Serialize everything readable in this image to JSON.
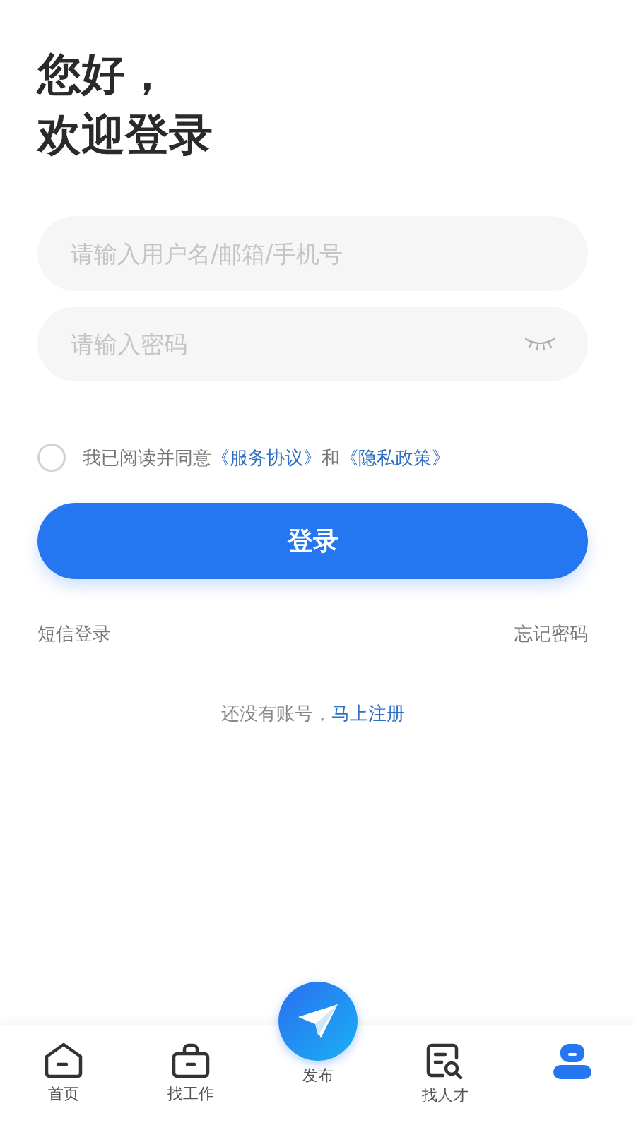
{
  "greeting": [
    "您好，",
    "欢迎登录"
  ],
  "username_field": {
    "placeholder": "请输入用户名/邮箱/手机号"
  },
  "password_field": {
    "placeholder": "请输入密码",
    "visible": false
  },
  "agreement": {
    "checked": false,
    "text": "我已阅读并同意",
    "links": [
      "《服务协议》",
      "《隐私政策》"
    ],
    "joiner": "和"
  },
  "login_button": "登录",
  "sms_login": "短信登录",
  "forgot_password": "忘记密码",
  "register_prompt": {
    "text": "还没有账号，",
    "link": "马上注册"
  },
  "tab_bar": [
    {
      "kind": "home",
      "label": "首页",
      "selected": false
    },
    {
      "kind": "jobs",
      "label": "找工作",
      "selected": false
    },
    {
      "kind": "publish",
      "label": "发布",
      "selected": false
    },
    {
      "kind": "talent",
      "label": "找人才",
      "selected": false
    },
    {
      "kind": "profile",
      "selected": true
    }
  ]
}
